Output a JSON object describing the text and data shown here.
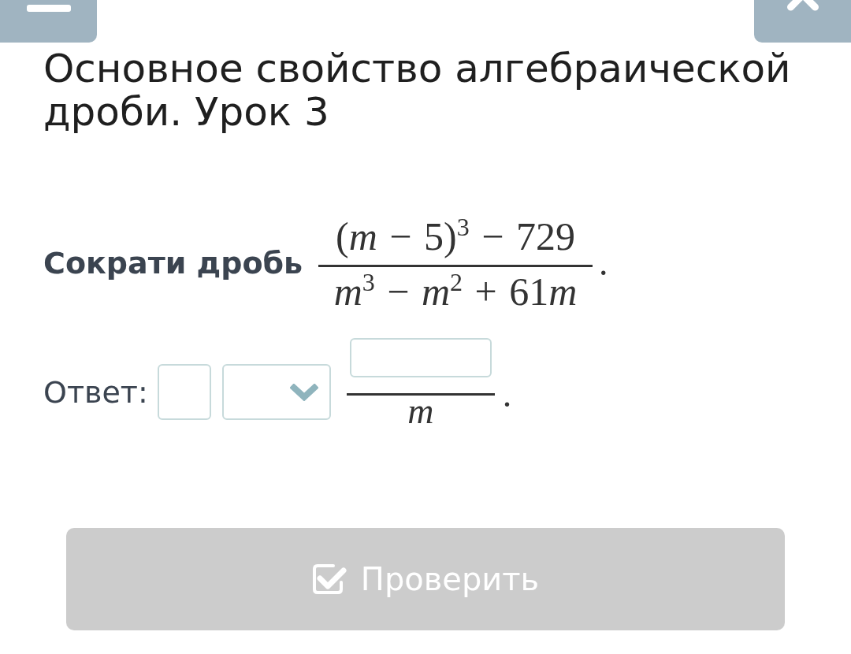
{
  "top_bar": {
    "buttons": [
      {
        "kind": "minus"
      },
      {
        "kind": "close"
      }
    ]
  },
  "title": "Основное свойство алгебраической дроби. Урок 3",
  "task": {
    "prompt": "Сократи дробь",
    "fraction": {
      "numerator": "(m − 5)$^{3}$ − 729",
      "denominator": "m$^{3}$ − m$^{2}$ + 61m"
    },
    "end": "."
  },
  "answer": {
    "label": "Ответ:",
    "parts": [
      {
        "kind": "input"
      },
      {
        "kind": "dropdown"
      },
      {
        "kind": "fraction",
        "denominator": "m"
      }
    ],
    "end": "."
  },
  "check_button": {
    "label": "Проверить",
    "disabled": true
  }
}
